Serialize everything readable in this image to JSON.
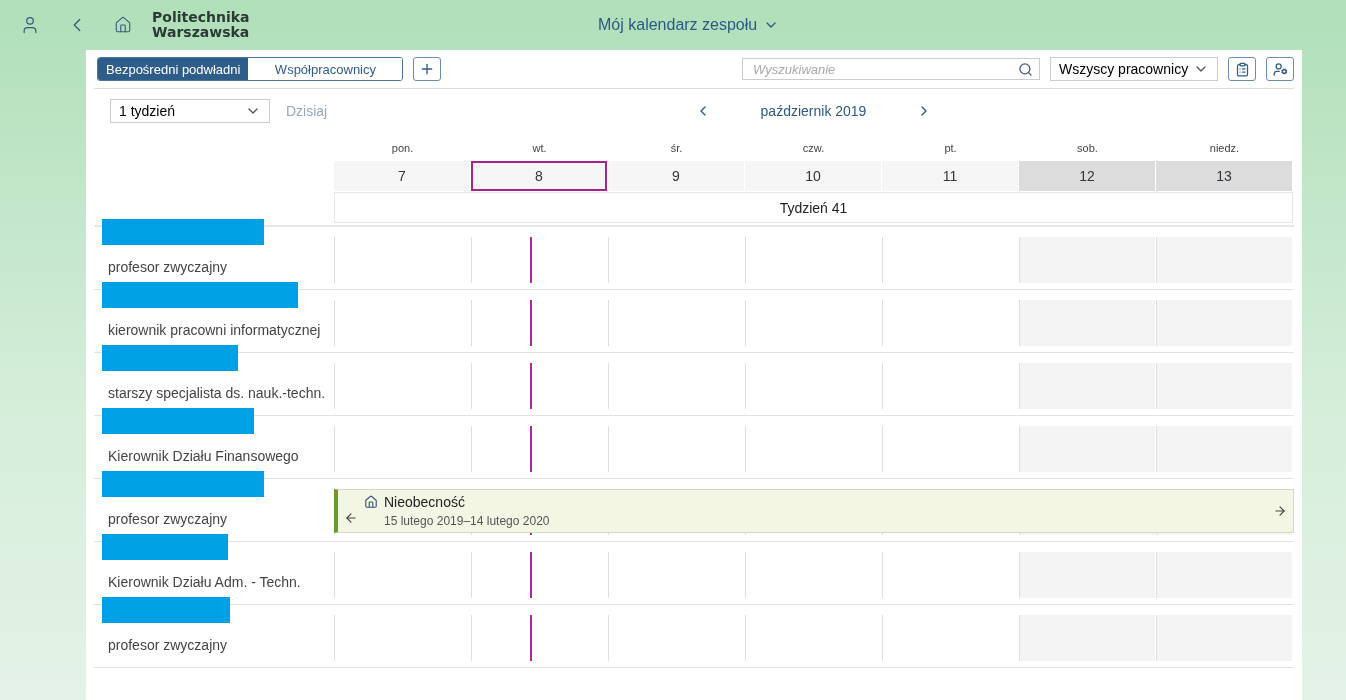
{
  "header": {
    "logo": [
      "Politechnika",
      "Warszawska"
    ],
    "title": "Mój kalendarz zespołu"
  },
  "tabs": [
    {
      "label": "Bezpośredni podwładni",
      "selected": true
    },
    {
      "label": "Współpracownicy",
      "selected": false
    }
  ],
  "search": {
    "placeholder": "Wyszukiwanie"
  },
  "filter": {
    "value": "Wszyscy pracownicy"
  },
  "period": {
    "value": "1 tydzień"
  },
  "today_button": "Dzisiaj",
  "month": "październik 2019",
  "days": [
    {
      "weekday": "pon.",
      "date": "7",
      "today": false,
      "weekend": false
    },
    {
      "weekday": "wt.",
      "date": "8",
      "today": true,
      "weekend": false
    },
    {
      "weekday": "śr.",
      "date": "9",
      "today": false,
      "weekend": false
    },
    {
      "weekday": "czw.",
      "date": "10",
      "today": false,
      "weekend": false
    },
    {
      "weekday": "pt.",
      "date": "11",
      "today": false,
      "weekend": false
    },
    {
      "weekday": "sob.",
      "date": "12",
      "today": false,
      "weekend": true
    },
    {
      "weekday": "niedz.",
      "date": "13",
      "today": false,
      "weekend": true
    }
  ],
  "week": "Tydzień 41",
  "employees": [
    {
      "title": "profesor zwyczajny"
    },
    {
      "title": "kierownik pracowni informatycznej"
    },
    {
      "title": "starszy specjalista ds. nauk.-techn."
    },
    {
      "title": "Kierownik Działu Finansowego"
    },
    {
      "title": "profesor zwyczajny",
      "event": {
        "title": "Nieobecność",
        "dates": "15 lutego 2019–14 lutego 2020"
      }
    },
    {
      "title": "Kierownik Działu Adm. - Techn."
    },
    {
      "title": "profesor zwyczajny"
    }
  ]
}
